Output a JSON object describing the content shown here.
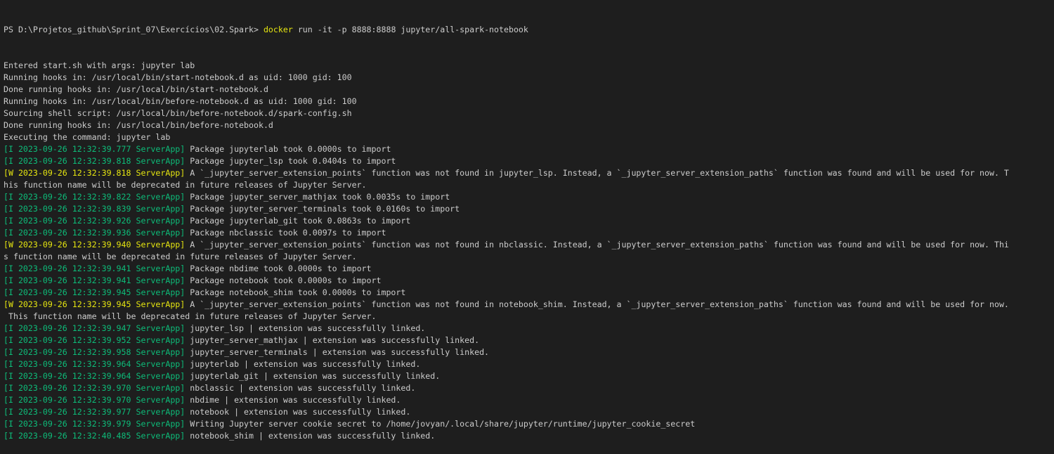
{
  "prompt": {
    "path": "PS D:\\Projetos_github\\Sprint_07\\Exercícios\\02.Spark> ",
    "command": "docker",
    "args": " run -it -p 8888:8888 jupyter/all-spark-notebook"
  },
  "colors": {
    "background": "#1e1e1e",
    "foreground": "#cccccc",
    "info_tag": "#0dbc79",
    "warn_tag": "#e5e510",
    "command": "#e5e510"
  },
  "lines": [
    {
      "tag": "",
      "level": "plain",
      "text": "Entered start.sh with args: jupyter lab"
    },
    {
      "tag": "",
      "level": "plain",
      "text": "Running hooks in: /usr/local/bin/start-notebook.d as uid: 1000 gid: 100"
    },
    {
      "tag": "",
      "level": "plain",
      "text": "Done running hooks in: /usr/local/bin/start-notebook.d"
    },
    {
      "tag": "",
      "level": "plain",
      "text": "Running hooks in: /usr/local/bin/before-notebook.d as uid: 1000 gid: 100"
    },
    {
      "tag": "",
      "level": "plain",
      "text": "Sourcing shell script: /usr/local/bin/before-notebook.d/spark-config.sh"
    },
    {
      "tag": "",
      "level": "plain",
      "text": "Done running hooks in: /usr/local/bin/before-notebook.d"
    },
    {
      "tag": "",
      "level": "plain",
      "text": "Executing the command: jupyter lab"
    },
    {
      "tag": "[I 2023-09-26 12:32:39.777 ServerApp]",
      "level": "info",
      "text": " Package jupyterlab took 0.0000s to import"
    },
    {
      "tag": "[I 2023-09-26 12:32:39.818 ServerApp]",
      "level": "info",
      "text": " Package jupyter_lsp took 0.0404s to import"
    },
    {
      "tag": "[W 2023-09-26 12:32:39.818 ServerApp]",
      "level": "warn",
      "text": " A `_jupyter_server_extension_points` function was not found in jupyter_lsp. Instead, a `_jupyter_server_extension_paths` function was found and will be used for now. T"
    },
    {
      "tag": "",
      "level": "plain",
      "text": "his function name will be deprecated in future releases of Jupyter Server."
    },
    {
      "tag": "[I 2023-09-26 12:32:39.822 ServerApp]",
      "level": "info",
      "text": " Package jupyter_server_mathjax took 0.0035s to import"
    },
    {
      "tag": "[I 2023-09-26 12:32:39.839 ServerApp]",
      "level": "info",
      "text": " Package jupyter_server_terminals took 0.0160s to import"
    },
    {
      "tag": "[I 2023-09-26 12:32:39.926 ServerApp]",
      "level": "info",
      "text": " Package jupyterlab_git took 0.0863s to import"
    },
    {
      "tag": "[I 2023-09-26 12:32:39.936 ServerApp]",
      "level": "info",
      "text": " Package nbclassic took 0.0097s to import"
    },
    {
      "tag": "[W 2023-09-26 12:32:39.940 ServerApp]",
      "level": "warn",
      "text": " A `_jupyter_server_extension_points` function was not found in nbclassic. Instead, a `_jupyter_server_extension_paths` function was found and will be used for now. Thi"
    },
    {
      "tag": "",
      "level": "plain",
      "text": "s function name will be deprecated in future releases of Jupyter Server."
    },
    {
      "tag": "[I 2023-09-26 12:32:39.941 ServerApp]",
      "level": "info",
      "text": " Package nbdime took 0.0000s to import"
    },
    {
      "tag": "[I 2023-09-26 12:32:39.941 ServerApp]",
      "level": "info",
      "text": " Package notebook took 0.0000s to import"
    },
    {
      "tag": "[I 2023-09-26 12:32:39.945 ServerApp]",
      "level": "info",
      "text": " Package notebook_shim took 0.0000s to import"
    },
    {
      "tag": "[W 2023-09-26 12:32:39.945 ServerApp]",
      "level": "warn",
      "text": " A `_jupyter_server_extension_points` function was not found in notebook_shim. Instead, a `_jupyter_server_extension_paths` function was found and will be used for now."
    },
    {
      "tag": "",
      "level": "plain",
      "text": " This function name will be deprecated in future releases of Jupyter Server."
    },
    {
      "tag": "[I 2023-09-26 12:32:39.947 ServerApp]",
      "level": "info",
      "text": " jupyter_lsp | extension was successfully linked."
    },
    {
      "tag": "[I 2023-09-26 12:32:39.952 ServerApp]",
      "level": "info",
      "text": " jupyter_server_mathjax | extension was successfully linked."
    },
    {
      "tag": "[I 2023-09-26 12:32:39.958 ServerApp]",
      "level": "info",
      "text": " jupyter_server_terminals | extension was successfully linked."
    },
    {
      "tag": "[I 2023-09-26 12:32:39.964 ServerApp]",
      "level": "info",
      "text": " jupyterlab | extension was successfully linked."
    },
    {
      "tag": "[I 2023-09-26 12:32:39.964 ServerApp]",
      "level": "info",
      "text": " jupyterlab_git | extension was successfully linked."
    },
    {
      "tag": "[I 2023-09-26 12:32:39.970 ServerApp]",
      "level": "info",
      "text": " nbclassic | extension was successfully linked."
    },
    {
      "tag": "[I 2023-09-26 12:32:39.970 ServerApp]",
      "level": "info",
      "text": " nbdime | extension was successfully linked."
    },
    {
      "tag": "[I 2023-09-26 12:32:39.977 ServerApp]",
      "level": "info",
      "text": " notebook | extension was successfully linked."
    },
    {
      "tag": "[I 2023-09-26 12:32:39.979 ServerApp]",
      "level": "info",
      "text": " Writing Jupyter server cookie secret to /home/jovyan/.local/share/jupyter/runtime/jupyter_cookie_secret"
    },
    {
      "tag": "[I 2023-09-26 12:32:40.485 ServerApp]",
      "level": "info",
      "text": " notebook_shim | extension was successfully linked."
    }
  ]
}
